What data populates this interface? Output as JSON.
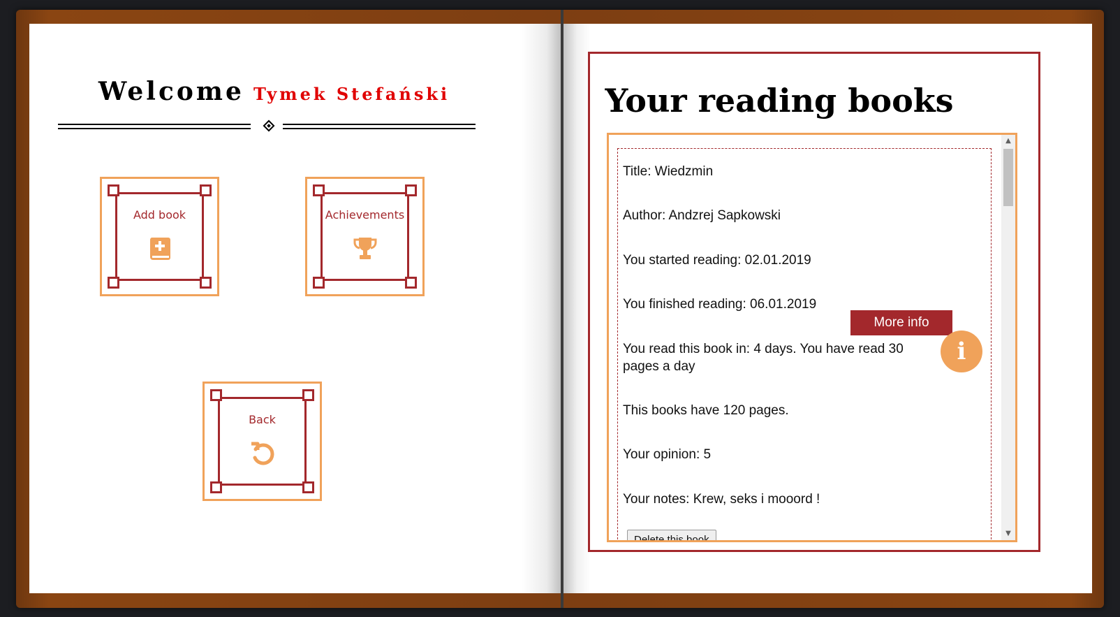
{
  "left_page": {
    "welcome_word": "Welcome",
    "user_name": "Tymek Stefański",
    "tiles": {
      "add_book": {
        "label": "Add book",
        "icon": "book-plus-icon"
      },
      "achievements": {
        "label": "Achievements",
        "icon": "trophy-icon"
      },
      "back": {
        "label": "Back",
        "icon": "undo-icon"
      }
    }
  },
  "right_page": {
    "title": "Your reading books",
    "book": {
      "title": "Title: Wiedzmin",
      "author": "Author: Andzrej Sapkowski",
      "started": "You started reading: 02.01.2019",
      "finished": "You finished reading: 06.01.2019",
      "duration": "You read this book in: 4 days. You have read 30 pages a day",
      "pages": "This books have 120 pages.",
      "opinion": "Your opinion: 5",
      "notes": "Your notes: Krew, seks i mooord !",
      "more_info_label": "More info",
      "info_icon_glyph": "i",
      "delete_label": "Delete this book"
    }
  },
  "colors": {
    "accent_red": "#a3282c",
    "accent_orange": "#f0a25a",
    "name_red": "#e00000",
    "cover_brown": "#7d3e12"
  }
}
